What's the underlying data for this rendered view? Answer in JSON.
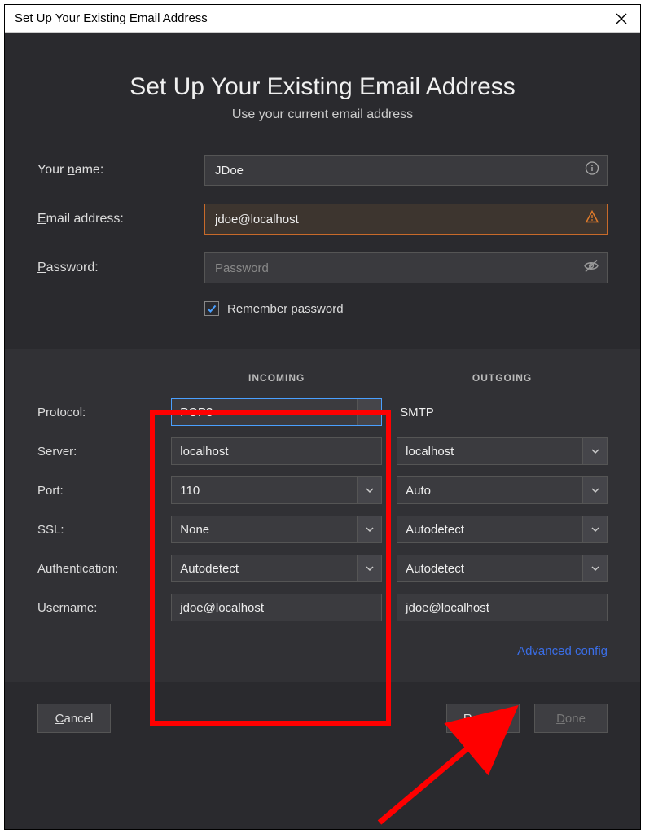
{
  "titlebar": {
    "title": "Set Up Your Existing Email Address"
  },
  "heading": {
    "title": "Set Up Your Existing Email Address",
    "subtitle": "Use your current email address"
  },
  "form": {
    "name_label_pre": "Your ",
    "name_label_u": "n",
    "name_label_post": "ame:",
    "name_value": "JDoe",
    "email_label_u": "E",
    "email_label_post": "mail address:",
    "email_value": "jdoe@localhost",
    "password_label_u": "P",
    "password_label_post": "assword:",
    "password_placeholder": "Password",
    "remember_pre": "Re",
    "remember_u": "m",
    "remember_post": "ember password"
  },
  "config": {
    "incoming_header": "INCOMING",
    "outgoing_header": "OUTGOING",
    "labels": {
      "protocol": "Protocol:",
      "server": "Server:",
      "port": "Port:",
      "ssl": "SSL:",
      "auth": "Authentication:",
      "username": "Username:"
    },
    "incoming": {
      "protocol": "POP3",
      "server": "localhost",
      "port": "110",
      "ssl": "None",
      "auth": "Autodetect",
      "username": "jdoe@localhost"
    },
    "outgoing": {
      "protocol": "SMTP",
      "server": "localhost",
      "port": "Auto",
      "ssl": "Autodetect",
      "auth": "Autodetect",
      "username": "jdoe@localhost"
    },
    "advanced_link": "Advanced config"
  },
  "buttons": {
    "cancel_pre": "",
    "cancel_u": "C",
    "cancel_post": "ancel",
    "retest_pre": "Re-",
    "retest_u": "t",
    "retest_post": "est",
    "done_u": "D",
    "done_post": "one"
  }
}
